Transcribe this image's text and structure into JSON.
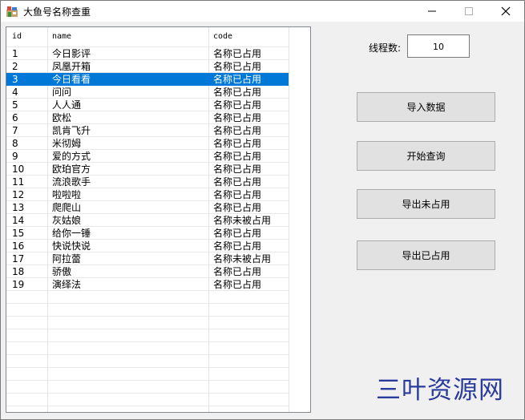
{
  "window": {
    "title": "大鱼号名称查重"
  },
  "grid": {
    "columns": [
      "id",
      "name",
      "code"
    ],
    "selected_index": 2,
    "rows": [
      {
        "id": "1",
        "name": "今日影评",
        "code": "名称已占用"
      },
      {
        "id": "2",
        "name": "凤凰开箱",
        "code": "名称已占用"
      },
      {
        "id": "3",
        "name": "今日看看",
        "code": "名称已占用"
      },
      {
        "id": "4",
        "name": "问问",
        "code": "名称已占用"
      },
      {
        "id": "5",
        "name": "人人通",
        "code": "名称已占用"
      },
      {
        "id": "6",
        "name": "欧松",
        "code": "名称已占用"
      },
      {
        "id": "7",
        "name": "凯肯飞升",
        "code": "名称已占用"
      },
      {
        "id": "8",
        "name": "米彻姆",
        "code": "名称已占用"
      },
      {
        "id": "9",
        "name": "爱的方式",
        "code": "名称已占用"
      },
      {
        "id": "10",
        "name": "欧珀官方",
        "code": "名称已占用"
      },
      {
        "id": "11",
        "name": "流浪歌手",
        "code": "名称已占用"
      },
      {
        "id": "12",
        "name": "啦啦啦",
        "code": "名称已占用"
      },
      {
        "id": "13",
        "name": "爬爬山",
        "code": "名称已占用"
      },
      {
        "id": "14",
        "name": "灰姑娘",
        "code": "名称未被占用"
      },
      {
        "id": "15",
        "name": "给你一锤",
        "code": "名称已占用"
      },
      {
        "id": "16",
        "name": "快说快说",
        "code": "名称已占用"
      },
      {
        "id": "17",
        "name": "阿拉蕾",
        "code": "名称未被占用"
      },
      {
        "id": "18",
        "name": "骄傲",
        "code": "名称已占用"
      },
      {
        "id": "19",
        "name": "演绎法",
        "code": "名称已占用"
      }
    ]
  },
  "controls": {
    "thread_label": "线程数:",
    "thread_value": "10",
    "import_label": "导入数据",
    "start_label": "开始查询",
    "export_unused_label": "导出未占用",
    "export_used_label": "导出已占用"
  },
  "watermark": {
    "text": "三叶资源网",
    "color": "#2a3b9b"
  },
  "colors": {
    "selection": "#0078d7",
    "button_bg": "#e1e1e1",
    "window_bg": "#f0f0f0"
  }
}
